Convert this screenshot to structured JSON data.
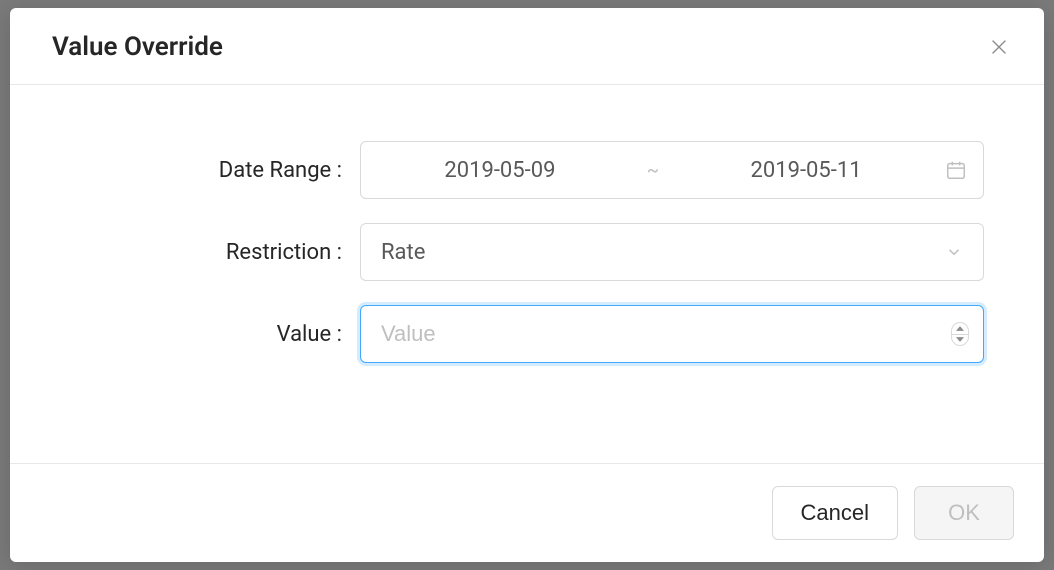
{
  "modal": {
    "title": "Value Override",
    "form": {
      "dateRange": {
        "label": "Date Range :",
        "start": "2019-05-09",
        "end": "2019-05-11",
        "separator": "~"
      },
      "restriction": {
        "label": "Restriction :",
        "value": "Rate"
      },
      "value": {
        "label": "Value :",
        "placeholder": "Value",
        "value": ""
      }
    },
    "footer": {
      "cancel": "Cancel",
      "ok": "OK"
    }
  }
}
